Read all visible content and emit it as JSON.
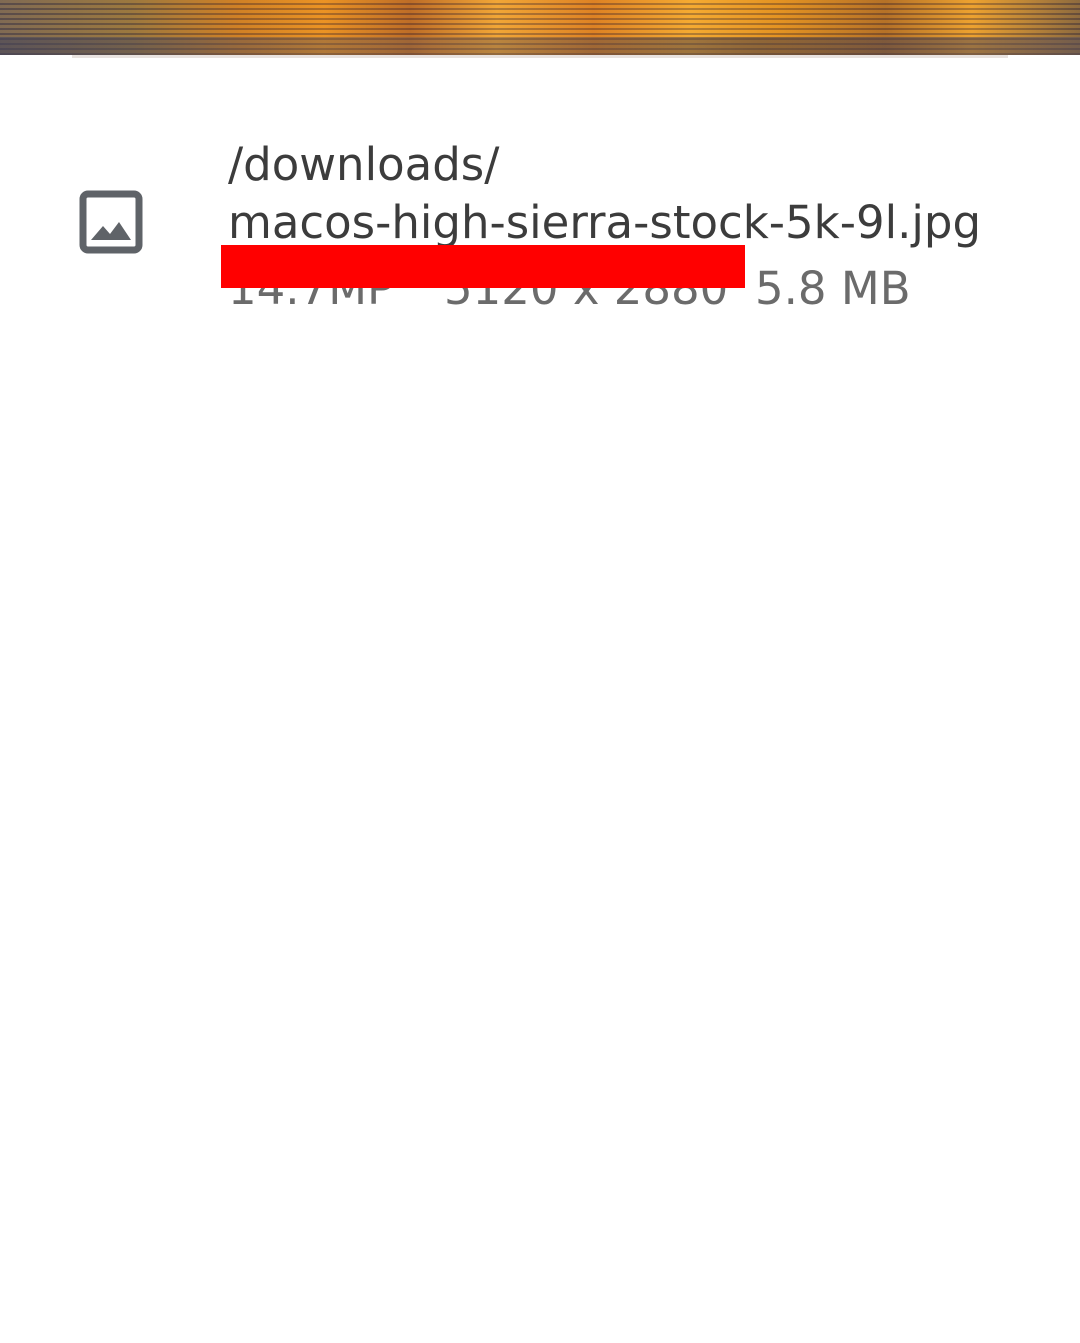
{
  "photo": {
    "icon": "image-preview-strip"
  },
  "file_info": {
    "icon": "image-icon",
    "path": "/downloads/\nmacos-high-sierra-stock-5k-9l.jpg",
    "megapixels": "14.7MP",
    "resolution": "5120 x 2880",
    "size": "5.8 MB"
  },
  "colors": {
    "redaction": "#ff0000",
    "text_primary": "#3c3c3c",
    "text_secondary": "#6b6b6b",
    "icon": "#5f6368"
  }
}
